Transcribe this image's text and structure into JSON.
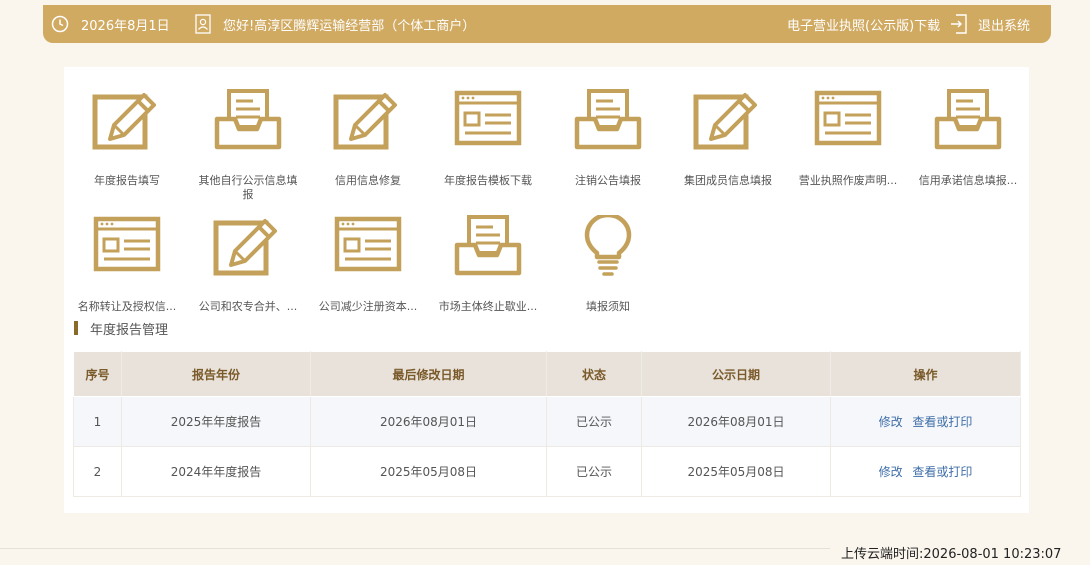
{
  "header": {
    "date": "2026年8月1日",
    "greeting": "您好!高淳区腾辉运输经营部（个体工商户）",
    "license_download": "电子营业执照(公示版)下载",
    "logout": "退出系统"
  },
  "tiles": [
    {
      "name": "annual-report-fill",
      "label": "年度报告填写",
      "icon": "form-pencil-icon"
    },
    {
      "name": "other-disclosure",
      "label": "其他自行公示信息填报",
      "icon": "inbox-icon"
    },
    {
      "name": "credit-repair",
      "label": "信用信息修复",
      "icon": "form-pencil-icon"
    },
    {
      "name": "template-download",
      "label": "年度报告模板下载",
      "icon": "window-list-icon"
    },
    {
      "name": "cancel-notice",
      "label": "注销公告填报",
      "icon": "inbox-icon"
    },
    {
      "name": "group-members",
      "label": "集团成员信息填报",
      "icon": "form-pencil-icon"
    },
    {
      "name": "license-void",
      "label": "营业执照作废声明...",
      "icon": "window-list-icon"
    },
    {
      "name": "credit-commitment",
      "label": "信用承诺信息填报...",
      "icon": "inbox-icon"
    },
    {
      "name": "name-transfer",
      "label": "名称转让及授权信...",
      "icon": "window-list-icon"
    },
    {
      "name": "merger",
      "label": "公司和农专合并、...",
      "icon": "form-pencil-icon"
    },
    {
      "name": "capital-reduction",
      "label": "公司减少注册资本...",
      "icon": "window-list-icon"
    },
    {
      "name": "termination",
      "label": "市场主体终止歇业...",
      "icon": "inbox-icon"
    },
    {
      "name": "instructions",
      "label": "填报须知",
      "icon": "lightbulb-icon"
    }
  ],
  "section": {
    "title": "年度报告管理"
  },
  "table": {
    "headers": [
      "序号",
      "报告年份",
      "最后修改日期",
      "状态",
      "公示日期",
      "操作"
    ],
    "rows": [
      {
        "no": "1",
        "year": "2025年年度报告",
        "modified": "2026年08月01日",
        "status": "已公示",
        "published": "2026年08月01日",
        "edit": "修改",
        "view": "查看或打印"
      },
      {
        "no": "2",
        "year": "2024年年度报告",
        "modified": "2025年05月08日",
        "status": "已公示",
        "published": "2025年05月08日",
        "edit": "修改",
        "view": "查看或打印"
      }
    ]
  },
  "footer": {
    "upload_time": "上传云端时间:2026-08-01 10:23:07"
  },
  "colors": {
    "accent": "#d1aa62",
    "icon": "#c4a15a",
    "link": "#3f6ea8"
  }
}
